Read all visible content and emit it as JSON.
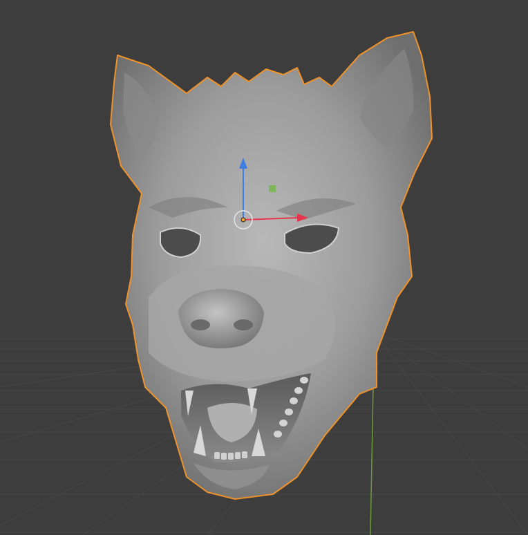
{
  "viewport": {
    "background": "#3d3d3d",
    "grid_color": "#4a4a4a",
    "z_axis_color": "#6c9a3a",
    "selection_outline_color": "#f0922a",
    "mesh_color": "#9a9a9a"
  },
  "object": {
    "icon": "hyena-mask-mesh",
    "selected": true
  },
  "gizmo": {
    "x_axis_color": "#e8364c",
    "y_axis_color": "#74b84a",
    "z_axis_color": "#3f7fe0",
    "origin_color": "#f0a030"
  }
}
